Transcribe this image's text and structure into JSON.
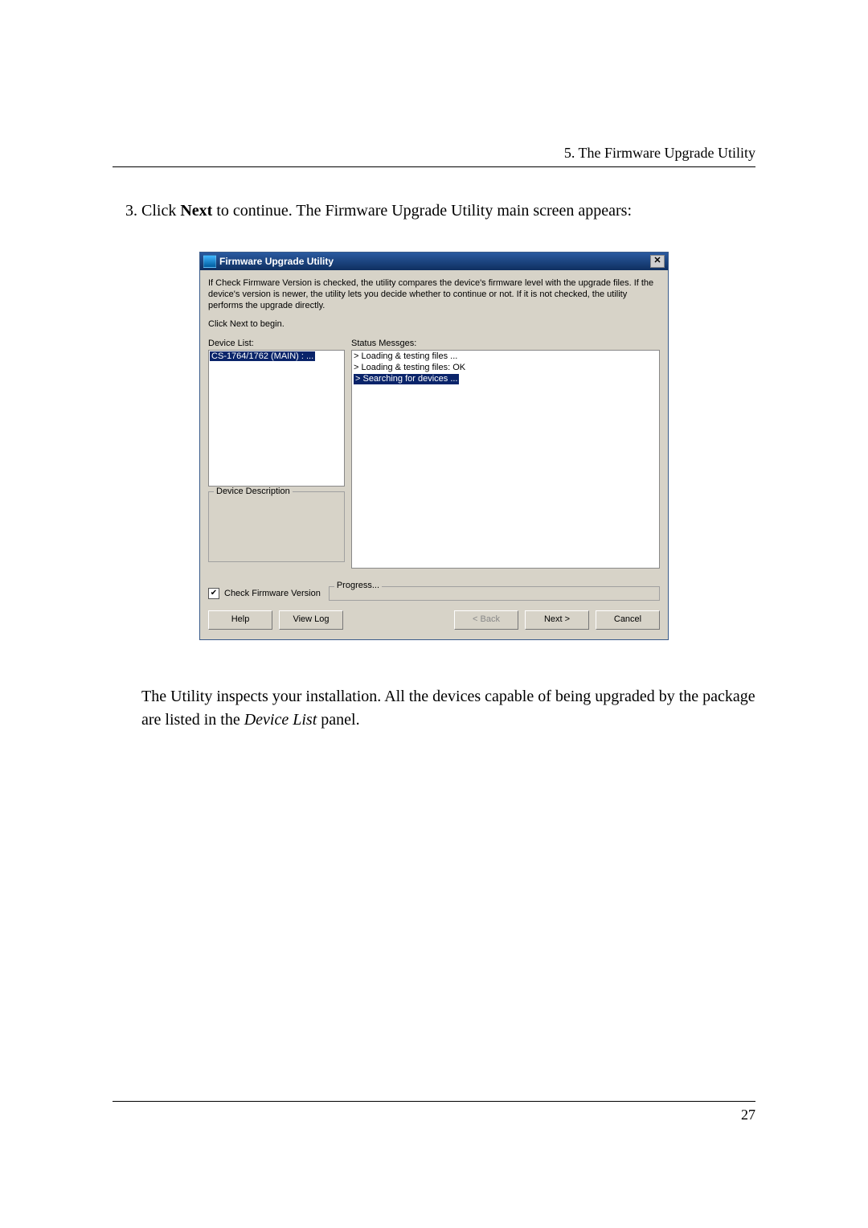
{
  "doc_header": "5. The Firmware Upgrade Utility",
  "step_number": "3.",
  "step_text_a": "Click ",
  "step_text_bold": "Next",
  "step_text_b": " to continue. The Firmware Upgrade Utility main screen appears:",
  "dialog": {
    "title": "Firmware Upgrade Utility",
    "intro": "If Check Firmware Version is checked, the utility compares the device's firmware level with the upgrade files. If the device's version is newer, the utility lets you decide whether to continue or not. If it is not checked, the utility performs the upgrade directly.",
    "click_next": "Click Next to begin.",
    "device_list_label": "Device List:",
    "device_list_item": "CS-1764/1762 (MAIN) : ...",
    "status_label": "Status Messges:",
    "status_line1": "> Loading & testing files ...",
    "status_line2": "> Loading & testing files: OK",
    "status_line3": "> Searching for devices ...",
    "device_desc_legend": "Device Description",
    "chk_label": "Check Firmware Version",
    "progress_legend": "Progress...",
    "btn_help": "Help",
    "btn_viewlog": "View Log",
    "btn_back": "< Back",
    "btn_next": "Next >",
    "btn_cancel": "Cancel"
  },
  "explain_a": "The Utility inspects your installation. All the devices capable of being upgraded by the package are listed in the ",
  "explain_i": "Device List",
  "explain_b": " panel.",
  "page_number": "27"
}
